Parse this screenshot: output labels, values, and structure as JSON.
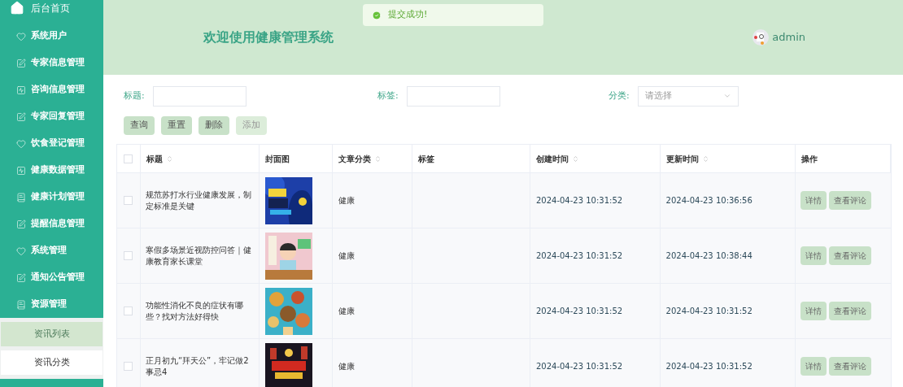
{
  "sidebar": {
    "home": {
      "label": "后台首页"
    },
    "items": [
      {
        "label": "系统用户"
      },
      {
        "label": "专家信息管理"
      },
      {
        "label": "咨询信息管理"
      },
      {
        "label": "专家回复管理"
      },
      {
        "label": "饮食登记管理"
      },
      {
        "label": "健康数据管理"
      },
      {
        "label": "健康计划管理"
      },
      {
        "label": "提醒信息管理"
      },
      {
        "label": "系统管理"
      },
      {
        "label": "通知公告管理"
      },
      {
        "label": "资源管理",
        "children": [
          {
            "label": "资讯列表",
            "selected": true
          },
          {
            "label": "资讯分类",
            "selected": false
          }
        ]
      }
    ]
  },
  "header": {
    "title": "欢迎使用健康管理系统",
    "user": "admin"
  },
  "toast": {
    "message": "提交成功!"
  },
  "search": {
    "fields": [
      {
        "label": "标题:",
        "kind": "input"
      },
      {
        "label": "标签:",
        "kind": "input"
      },
      {
        "label": "分类:",
        "kind": "select",
        "placeholder": "请选择"
      }
    ],
    "buttons": [
      {
        "label": "查询",
        "disabled": false
      },
      {
        "label": "重置",
        "disabled": false
      },
      {
        "label": "删除",
        "disabled": false
      },
      {
        "label": "添加",
        "disabled": true
      }
    ]
  },
  "table": {
    "all_checked": false,
    "columns": [
      {
        "label": "标题",
        "sortable": true
      },
      {
        "label": "封面图",
        "sortable": false
      },
      {
        "label": "文章分类",
        "sortable": true
      },
      {
        "label": "标签",
        "sortable": false
      },
      {
        "label": "创建时间",
        "sortable": true
      },
      {
        "label": "更新时间",
        "sortable": true
      },
      {
        "label": "操作",
        "sortable": false
      }
    ],
    "rows": [
      {
        "checked": false,
        "title": "规范苏打水行业健康发展，制定标准是关键",
        "cover": {
          "kind": "picture"
        },
        "category": "健康",
        "created": "2024-04-23 10:31:52",
        "updated": "2024-04-23 10:36:56",
        "actions": [
          "详情",
          "查看评论"
        ]
      },
      {
        "checked": false,
        "title": "寒假多场景近视防控问答｜健康教育家长课堂",
        "cover": {
          "kind": "picture"
        },
        "category": "健康",
        "created": "2024-04-23 10:31:52",
        "updated": "2024-04-23 10:38:44",
        "actions": [
          "详情",
          "查看评论"
        ]
      },
      {
        "checked": false,
        "title": "功能性消化不良的症状有哪些？找对方法好得快",
        "cover": {
          "kind": "picture"
        },
        "category": "健康",
        "created": "2024-04-23 10:31:52",
        "updated": "2024-04-23 10:31:52",
        "actions": [
          "详情",
          "查看评论"
        ]
      },
      {
        "checked": false,
        "title": "正月初九“拜天公”，牢记做2事忌4",
        "cover": {
          "kind": "picture"
        },
        "category": "健康",
        "created": "2024-04-23 10:31:52",
        "updated": "2024-04-23 10:31:52",
        "actions": [
          "详情",
          "查看评论"
        ]
      }
    ]
  }
}
